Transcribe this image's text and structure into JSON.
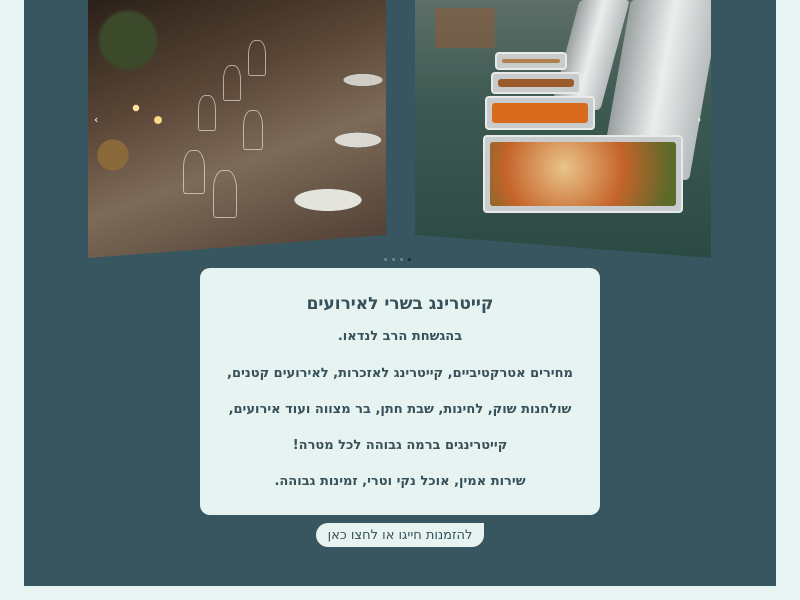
{
  "carousel": {
    "images": [
      {
        "alt": "table-setting-photo"
      },
      {
        "alt": "buffet-chafing-dishes-photo"
      }
    ],
    "prev_icon": "‹",
    "next_icon": "›",
    "slide_count": 4,
    "active_slide": 4
  },
  "card": {
    "title": "קייטרינג בשרי לאירועים",
    "lines": [
      "בהגשחת הרב לנדאו.",
      "מחירים אטרקטיביים, קייטרינג לאזכרות, לאירועים קטנים,",
      "שולחנות שוק, לחינות, שבת חתן, בר מצווה ועוד אירועים,",
      "קייטרינגים ברמה גבוהה לכל מטרה!",
      "שירות אמין, אוכל נקי וטרי, זמינות גבוהה."
    ]
  },
  "cta": {
    "label": "להזמנות חייגו או לחצו כאן"
  },
  "colors": {
    "page_bg": "#e8f4f1",
    "panel_bg": "#37565f",
    "card_bg": "#e6f3f0",
    "text": "#37515a"
  }
}
